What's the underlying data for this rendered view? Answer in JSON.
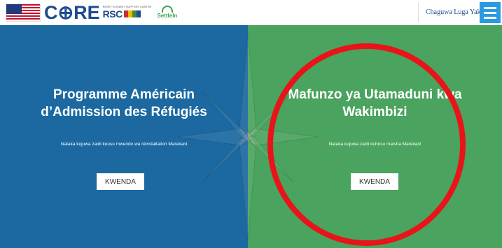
{
  "colors": {
    "left_panel": "#1b69a0",
    "right_panel": "#4aa35e",
    "menu_button": "#2a9be0",
    "highlight_circle": "#e8141a",
    "brand_blue": "#1f4b8f",
    "settle_green": "#3aa54a"
  },
  "header": {
    "logo": {
      "core": "C⊕RE",
      "rsc_tagline": "RESETTLEMENT SUPPORT CENTER",
      "rsc": "RSC",
      "settle_in": "Settleln"
    },
    "language_link": "Chaguwa Luga Yako",
    "menu_icon": "hamburger-icon"
  },
  "panels": {
    "left": {
      "title_line1": "Programme Américain",
      "title_line2": "d’Admission des Réfugiés",
      "subtitle": "Nataka kujuwa zaidi kuusu mwendo wa réinstallation Marekani",
      "button": "KWENDA"
    },
    "right": {
      "title_line1": "Mafunzo ya Utamaduni kwa",
      "title_line2": "Wakimbizi",
      "subtitle": "Nataka kujuwa zaidi kuhusu maisha Marekani",
      "button": "KWENDA"
    }
  },
  "decorations": {
    "background_icon": "compass-star-icon",
    "highlight": "red-circle-annotation"
  }
}
